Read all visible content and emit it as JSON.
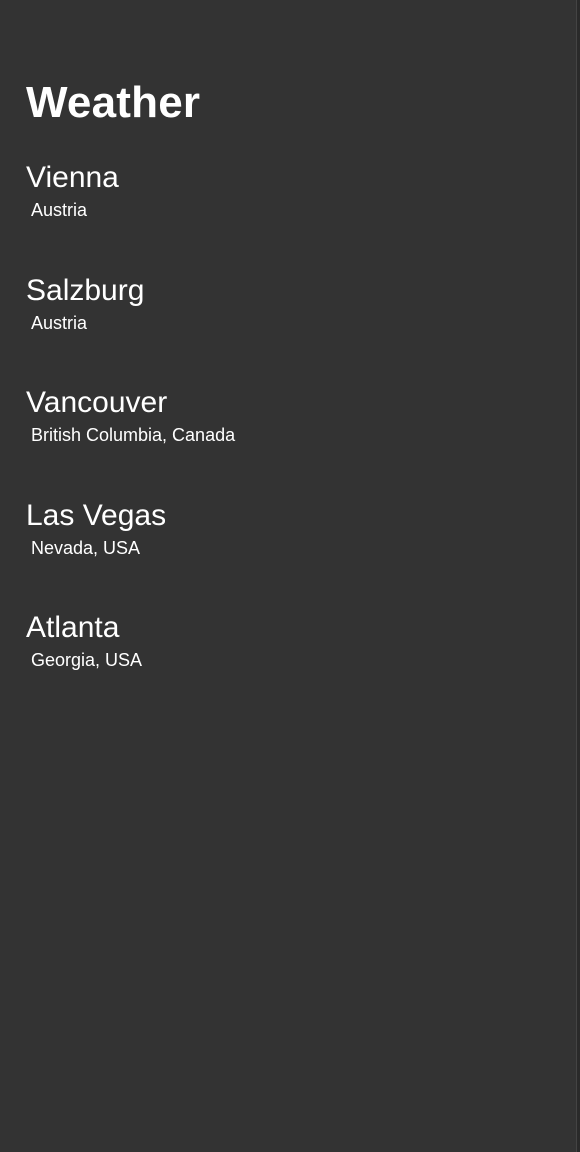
{
  "header": {
    "title": "Weather"
  },
  "locations": [
    {
      "city": "Vienna",
      "region": "Austria"
    },
    {
      "city": "Salzburg",
      "region": "Austria"
    },
    {
      "city": "Vancouver",
      "region": "British Columbia, Canada"
    },
    {
      "city": "Las Vegas",
      "region": "Nevada, USA"
    },
    {
      "city": "Atlanta",
      "region": "Georgia, USA"
    }
  ]
}
